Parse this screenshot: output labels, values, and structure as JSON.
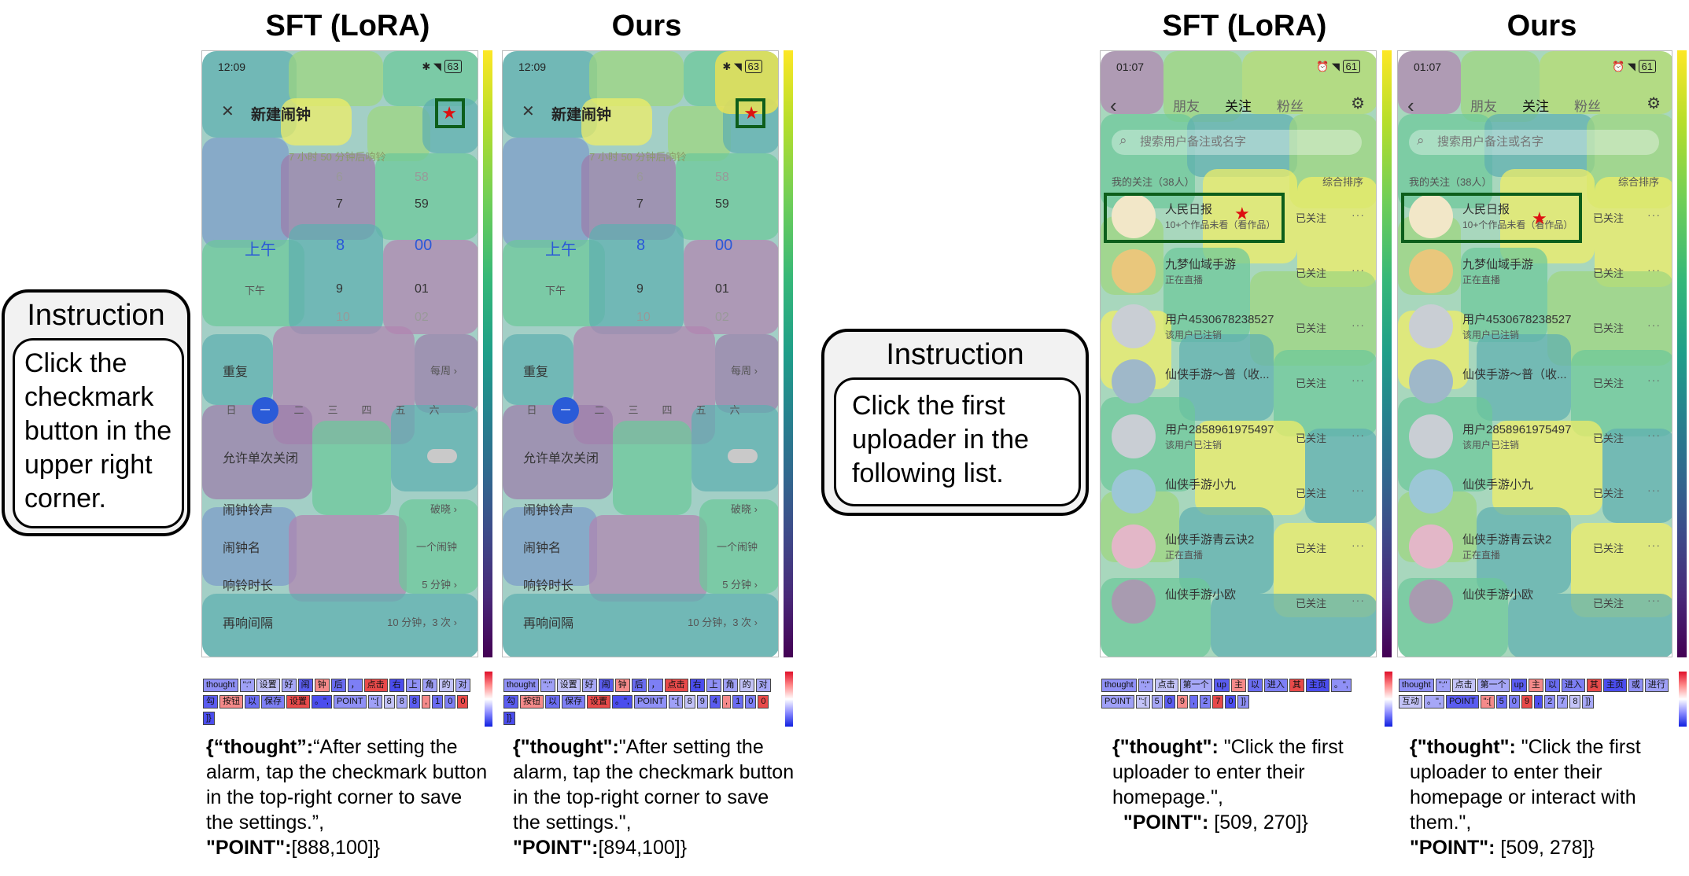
{
  "titles": {
    "left_sft": "SFT (LoRA)",
    "left_ours": "Ours",
    "right_sft": "SFT (LoRA)",
    "right_ours": "Ours"
  },
  "instructions": [
    {
      "label": "Instruction",
      "text": "Click the checkmark button in the upper right corner."
    },
    {
      "label": "Instruction",
      "text": "Click the first uploader in the following list."
    }
  ],
  "alarm_screen": {
    "time": "12:09",
    "battery": "63",
    "header": "新建闹钟",
    "subtitle": "7 小时 50 分钟后响铃",
    "col_hour_top": "6",
    "col_min_top": "58",
    "hour_prev": "7",
    "min_prev": "59",
    "ampm_am": "上午",
    "hour_sel": "8",
    "min_sel": "00",
    "ampm_pm": "下午",
    "hour_next": "9",
    "min_next": "01",
    "hour_next2": "10",
    "min_next2": "02",
    "repeat_label": "重复",
    "repeat_value": "每周 ›",
    "days": [
      "日",
      "一",
      "二",
      "三",
      "四",
      "五",
      "六"
    ],
    "allow_close": "允许单次关闭",
    "ringtone_label": "闹钟铃声",
    "ringtone_value": "破晓 ›",
    "name_label": "闹钟名",
    "name_value": "一个闹钟",
    "duration_label": "响铃时长",
    "duration_value": "5 分钟 ›",
    "snooze_label": "再响间隔",
    "snooze_value": "10 分钟，3 次 ›"
  },
  "follow_screen": {
    "time": "01:07",
    "battery": "61",
    "tabs": [
      "朋友",
      "关注",
      "粉丝"
    ],
    "search_placeholder": "搜索用户备注或名字",
    "count_label": "我的关注（38人）",
    "sort_label": "综合排序",
    "follow_label": "已关注",
    "more": "···",
    "users": [
      {
        "name": "人民日报",
        "sub": "10+个作品未看（看作品）",
        "avatar": "#f2e7c8"
      },
      {
        "name": "九梦仙域手游",
        "sub": "正在直播",
        "avatar": "#e9c77c"
      },
      {
        "name": "用户4530678238527",
        "sub": "该用户已注销",
        "avatar": "#c9ced4"
      },
      {
        "name": "仙侠手游～普（收...",
        "sub": "",
        "avatar": "#9fb8c9"
      },
      {
        "name": "用户2858961975497",
        "sub": "该用户已注销",
        "avatar": "#c9ced4"
      },
      {
        "name": "仙侠手游小九",
        "sub": "",
        "avatar": "#9cc7d6"
      },
      {
        "name": "仙侠手游青云诀2",
        "sub": "正在直播",
        "avatar": "#e3b7c8"
      },
      {
        "name": "仙侠手游小欧",
        "sub": "",
        "avatar": "#a89bb0"
      }
    ]
  },
  "tokens": {
    "p1": [
      "thought",
      "\":\"",
      "设置",
      "好",
      "闹",
      "钟",
      "后",
      "，",
      "点击",
      "右",
      "上",
      "角",
      "的",
      "对",
      "勾",
      "按钮",
      "以",
      "保存",
      "设置",
      "。\",",
      "POINT",
      "\":[",
      "8",
      "8",
      "8",
      ",",
      "1",
      "0",
      "0",
      "]}"
    ],
    "p2": [
      "thought",
      "\":\"",
      "设置",
      "好",
      "闹",
      "钟",
      "后",
      "，",
      "点击",
      "右",
      "上",
      "角",
      "的",
      "对",
      "勾",
      "按钮",
      "以",
      "保存",
      "设置",
      "。\",",
      "POINT",
      "\":[",
      "8",
      "9",
      "4",
      ",",
      "1",
      "0",
      "0",
      "]}"
    ],
    "p3": [
      "thought",
      "\":\"",
      "点击",
      "第一个",
      "up",
      "主",
      "以",
      "进入",
      "其",
      "主页",
      "。\",",
      "POINT",
      "\":[",
      "5",
      "0",
      "9",
      ",",
      "2",
      "7",
      "0",
      "]}"
    ],
    "p4": [
      "thought",
      "\":\"",
      "点击",
      "第一个",
      "up",
      "主",
      "以",
      "进入",
      "其",
      "主页",
      "或",
      "进行",
      "互动",
      "。\",",
      "POINT",
      "\":[",
      "5",
      "0",
      "9",
      ",",
      "2",
      "7",
      "8",
      "]}"
    ]
  },
  "captions": {
    "c1": {
      "thought_key": "{“thought”:",
      "thought_val": "“After setting the alarm, tap the checkmark button in the top-right corner to save the settings.”,",
      "point_key": "\"POINT\":",
      "point_val": "[888,100]}"
    },
    "c2": {
      "thought_key": "{\"thought\":",
      "thought_val": "\"After setting the alarm, tap the checkmark button in the top-right corner to save the settings.\",",
      "point_key": "\"POINT\":",
      "point_val": "[894,100]}"
    },
    "c3": {
      "thought_key": "{\"thought\":",
      "thought_val": " \"Click the first uploader to enter their homepage.\",",
      "point_key": "\"POINT\":",
      "point_val": " [509, 270]}"
    },
    "c4": {
      "thought_key": "{\"thought\":",
      "thought_val": " \"Click the first uploader to enter their homepage or interact with them.\",",
      "point_key": "\"POINT\":",
      "point_val": " [509, 278]}"
    }
  },
  "colors": {
    "target_box": "#0d5e1b",
    "star": "#dd1111",
    "selected_day": "#2a5bd8"
  }
}
